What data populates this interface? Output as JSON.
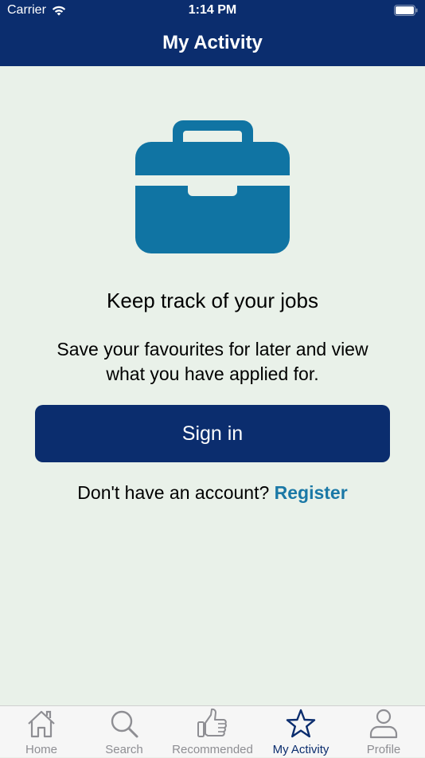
{
  "status_bar": {
    "carrier": "Carrier",
    "time": "1:14 PM"
  },
  "header": {
    "title": "My Activity"
  },
  "main": {
    "icon": "briefcase-icon",
    "heading": "Keep track of your jobs",
    "description_line1": "Save your favourites for later and view",
    "description_line2": "what you have applied for.",
    "signin_label": "Sign in",
    "register_prompt": "Don't have an account?",
    "register_link": "Register"
  },
  "tabs": [
    {
      "label": "Home",
      "icon": "home-icon"
    },
    {
      "label": "Search",
      "icon": "search-icon"
    },
    {
      "label": "Recommended",
      "icon": "thumbs-up-icon"
    },
    {
      "label": "My Activity",
      "icon": "star-icon",
      "active": true
    },
    {
      "label": "Profile",
      "icon": "person-icon"
    }
  ],
  "colors": {
    "primary": "#0b2d6e",
    "link": "#1a78a6",
    "briefcase": "#1074a3",
    "background": "#e9f1e9",
    "tab_inactive": "#8e8e93"
  }
}
